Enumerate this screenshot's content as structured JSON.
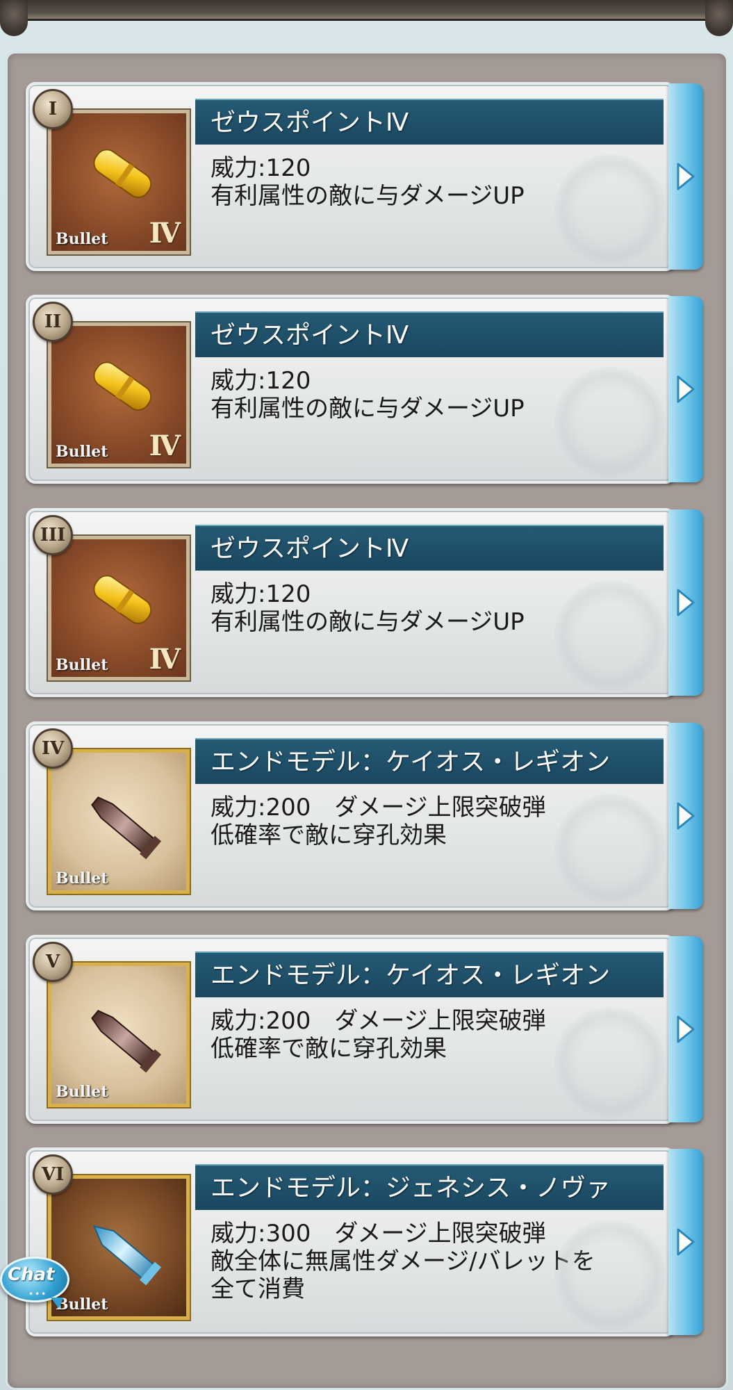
{
  "colors": {
    "title_bar": "#1f5069",
    "accent_arrow": "#5ab8e3",
    "panel_bg": "#a49b97"
  },
  "chat": {
    "label": "Chat",
    "dots": "•••"
  },
  "bullets": [
    {
      "slot": "I",
      "name": "ゼウスポイントⅣ",
      "desc_lines": [
        "威力:120",
        "有利属性の敵に与ダメージUP"
      ],
      "thumb_label": "Bullet",
      "rank": "Ⅳ",
      "icon": "gold-bullet-icon"
    },
    {
      "slot": "II",
      "name": "ゼウスポイントⅣ",
      "desc_lines": [
        "威力:120",
        "有利属性の敵に与ダメージUP"
      ],
      "thumb_label": "Bullet",
      "rank": "Ⅳ",
      "icon": "gold-bullet-icon"
    },
    {
      "slot": "III",
      "name": "ゼウスポイントⅣ",
      "desc_lines": [
        "威力:120",
        "有利属性の敵に与ダメージUP"
      ],
      "thumb_label": "Bullet",
      "rank": "Ⅳ",
      "icon": "gold-bullet-icon"
    },
    {
      "slot": "IV",
      "name": "エンドモデル：ケイオス・レギオン",
      "desc_lines": [
        "威力:200　ダメージ上限突破弾",
        "低確率で敵に穿孔効果"
      ],
      "thumb_label": "Bullet",
      "rank": "",
      "icon": "dark-bullet-icon"
    },
    {
      "slot": "V",
      "name": "エンドモデル：ケイオス・レギオン",
      "desc_lines": [
        "威力:200　ダメージ上限突破弾",
        "低確率で敵に穿孔効果"
      ],
      "thumb_label": "Bullet",
      "rank": "",
      "icon": "dark-bullet-icon"
    },
    {
      "slot": "VI",
      "name": "エンドモデル：ジェネシス・ノヴァ",
      "desc_lines": [
        "威力:300　ダメージ上限突破弾",
        "敵全体に無属性ダメージ/バレットを",
        "全て消費"
      ],
      "thumb_label": "Bullet",
      "rank": "",
      "icon": "crystal-bullet-icon"
    }
  ]
}
